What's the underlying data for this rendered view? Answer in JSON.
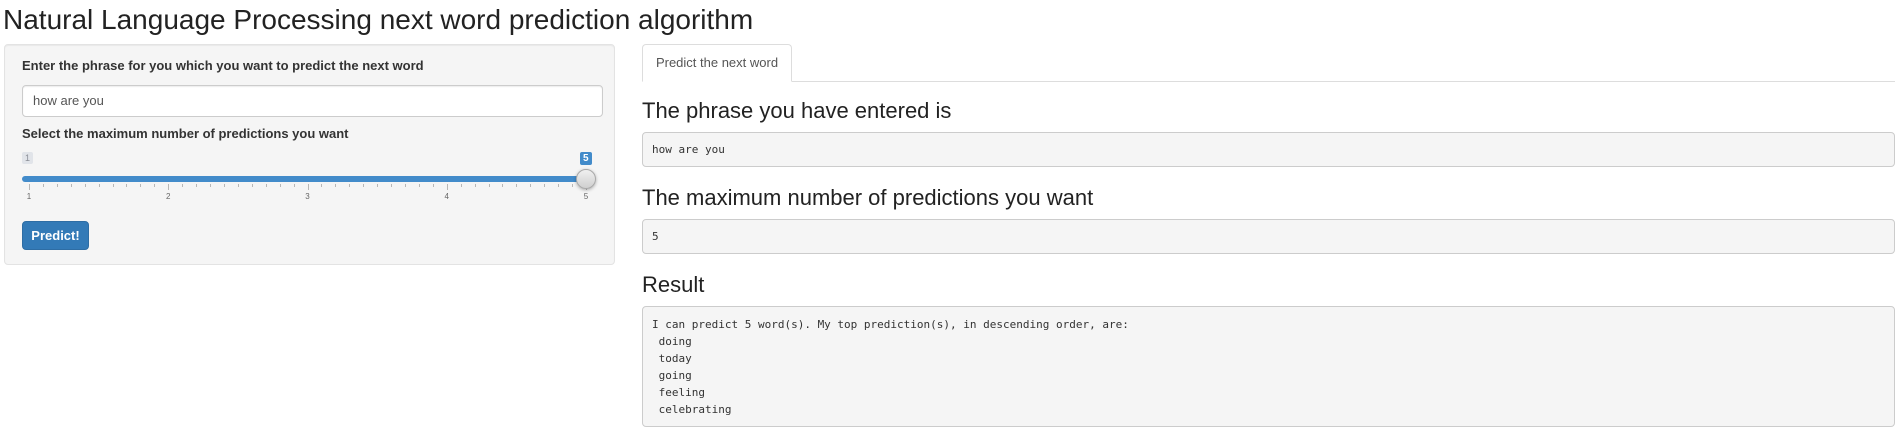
{
  "page": {
    "title": "Natural Language Processing next word prediction algorithm"
  },
  "sidebar": {
    "phrase_label": "Enter the phrase for you which you want to predict the next word",
    "phrase_value": "how are you",
    "slider_label": "Select the maximum number of predictions you want",
    "slider": {
      "min": 1,
      "max": 5,
      "value": 5,
      "min_badge": "1",
      "value_badge": "5",
      "tick_labels": [
        "1",
        "2",
        "3",
        "4",
        "5"
      ]
    },
    "predict_button": "Predict!"
  },
  "main": {
    "tab_label": "Predict the next word",
    "phrase_heading": "The phrase you have entered is",
    "phrase_output": "how are you",
    "max_heading": "The maximum number of predictions you want",
    "max_output": "5",
    "result_heading": "Result",
    "result_lines": [
      "I can predict 5 word(s). My top prediction(s), in descending order, are:",
      " doing",
      " today",
      " going",
      " feeling",
      " celebrating"
    ]
  },
  "colors": {
    "primary": "#337ab7",
    "slider_bar": "#428bca",
    "well_bg": "#f5f5f5"
  }
}
